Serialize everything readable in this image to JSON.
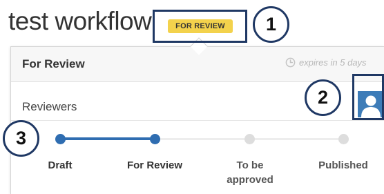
{
  "workflow": {
    "title": "test workflow",
    "status_badge": "FOR REVIEW"
  },
  "popover": {
    "title": "For Review",
    "expires": "expires in 5 days",
    "reviewers_label": "Reviewers"
  },
  "steps": [
    {
      "label": "Draft",
      "state": "done"
    },
    {
      "label": "For Review",
      "state": "current"
    },
    {
      "label": "To be approved",
      "state": "pending"
    },
    {
      "label": "Published",
      "state": "pending"
    }
  ],
  "callouts": [
    "1",
    "2",
    "3"
  ],
  "icons": {
    "clock": "clock-icon",
    "avatar": "user-avatar-icon"
  },
  "colors": {
    "badge": "#f3d24c",
    "accent": "#2f6db1",
    "callout": "#1f3864"
  }
}
